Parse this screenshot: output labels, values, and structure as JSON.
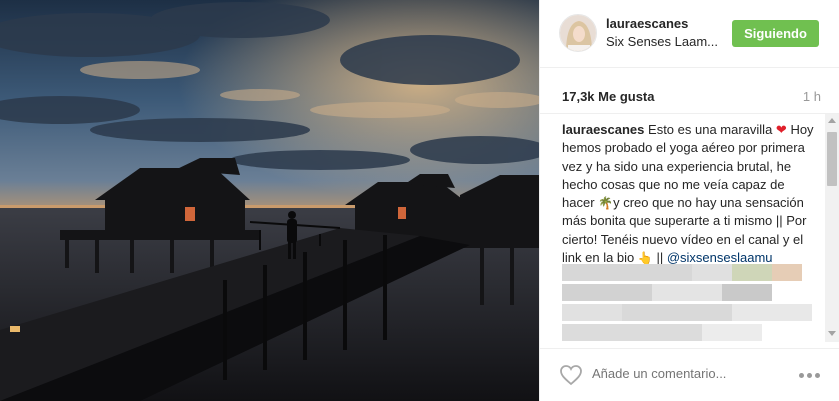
{
  "post": {
    "photo_description_icon": "photo-icon",
    "username": "lauraescanes",
    "location": "Six Senses Laam...",
    "follow_label": "Siguiendo",
    "likes": "17,3k Me gusta",
    "time": "1 h",
    "caption": {
      "username": "lauraescanes",
      "text_1": " Esto es una maravilla ",
      "heart_emoji": "❤",
      "text_2": " Hoy hemos probado el yoga aéreo por primera vez y ha sido una experiencia brutal, he hecho cosas que no me veía capaz de hacer ",
      "palm_emoji": "🌴",
      "text_3": "y creo que no hay una sensación más bonita que superarte a ti mismo || Por cierto! Tenéis nuevo vídeo en el canal y el link en la bio ",
      "hand_emoji": "👆",
      "text_4": " || ",
      "tag_1": "@sixsenseslaamu",
      "text_5": " ",
      "tag_2": "#toelrratour"
    },
    "comment_placeholder": "Añade un comentario...",
    "colors": {
      "follow_button": "#70c050",
      "link": "#003569",
      "heart": "#e0202b"
    }
  }
}
